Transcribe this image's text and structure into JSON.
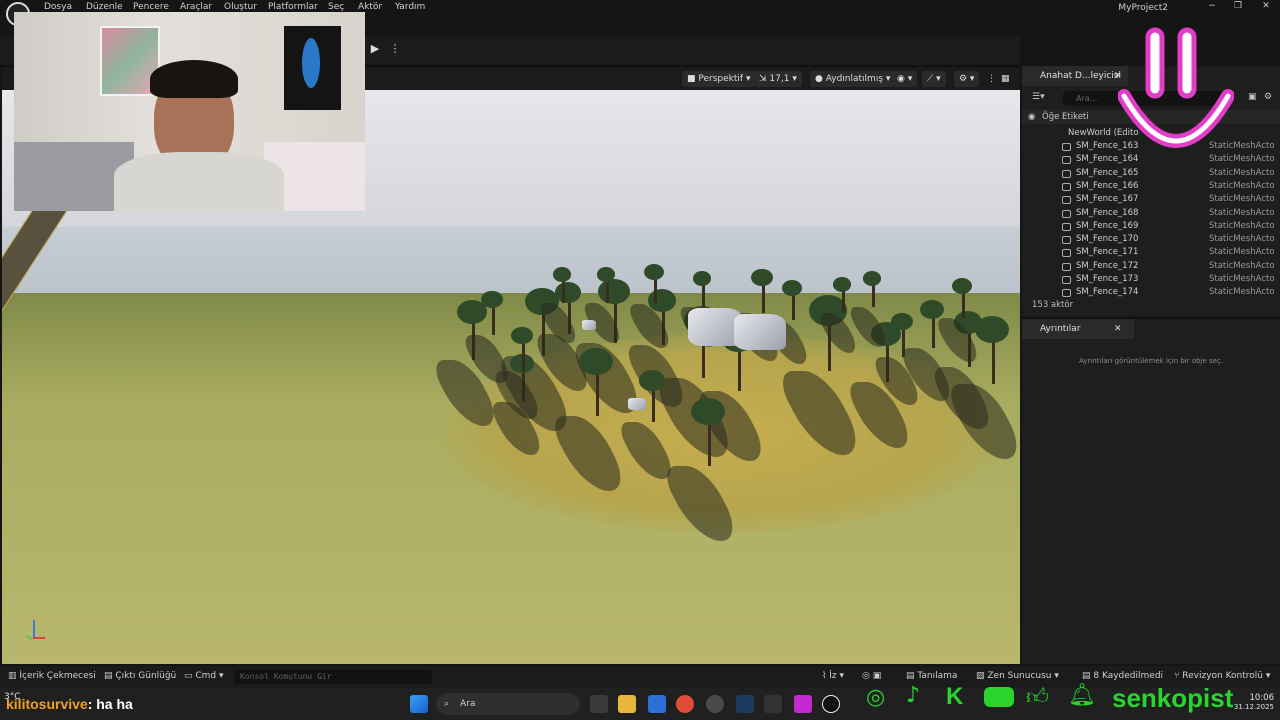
{
  "menu": [
    "Dosya",
    "Düzenle",
    "Pencere",
    "Araçlar",
    "Oluştur",
    "Platformlar",
    "Seç",
    "Aktör",
    "Yardım"
  ],
  "window_title": "MyProject2",
  "window_controls": [
    "−",
    "❐",
    "✕"
  ],
  "viewport_toolbar": {
    "perspective": "Perspektif",
    "fov": "17,1",
    "lighting": "Aydınlatılmış"
  },
  "outliner": {
    "tab_title": "Anahat D...leyicisi",
    "search_placeholder": "Ara...",
    "column_label": "Öğe Etiketi",
    "world_item": "NewWorld (Edito",
    "rows": [
      {
        "label": "SM_Fence_163",
        "type": "StaticMeshActo"
      },
      {
        "label": "SM_Fence_164",
        "type": "StaticMeshActo"
      },
      {
        "label": "SM_Fence_165",
        "type": "StaticMeshActo"
      },
      {
        "label": "SM_Fence_166",
        "type": "StaticMeshActo"
      },
      {
        "label": "SM_Fence_167",
        "type": "StaticMeshActo"
      },
      {
        "label": "SM_Fence_168",
        "type": "StaticMeshActo"
      },
      {
        "label": "SM_Fence_169",
        "type": "StaticMeshActo"
      },
      {
        "label": "SM_Fence_170",
        "type": "StaticMeshActo"
      },
      {
        "label": "SM_Fence_171",
        "type": "StaticMeshActo"
      },
      {
        "label": "SM_Fence_172",
        "type": "StaticMeshActo"
      },
      {
        "label": "SM_Fence_173",
        "type": "StaticMeshActo"
      },
      {
        "label": "SM_Fence_174",
        "type": "StaticMeshActo"
      }
    ],
    "actor_count": "153 aktör"
  },
  "details": {
    "tab_title": "Ayrıntılar",
    "empty_message": "Ayrıntıları görüntülemek için bir obje seç."
  },
  "bottom_bar": {
    "content_drawer": "İçerik Çekmecesi",
    "output_log": "Çıktı Günlüğü",
    "cmd": "Cmd",
    "console_placeholder": "Konsol Komutunu Gir",
    "trace": "İz",
    "diagnostics": "Tanılama",
    "zen_server": "Zen Sunucusu",
    "unsaved": "8 Kaydedilmedi",
    "revision_control": "Revizyon Kontrolü"
  },
  "taskbar": {
    "search_label": "Ara",
    "temperature": "3°C",
    "time": "10:06",
    "date": "31.12.2025"
  },
  "chat_overlay": {
    "user": "kilitosurvive",
    "message": ": ha ha"
  },
  "social_overlay": {
    "handle": "senkopist"
  },
  "colors": {
    "accent_pink": "#e23cc8",
    "chat_user": "#f0a020",
    "social_green": "#29d42c"
  }
}
